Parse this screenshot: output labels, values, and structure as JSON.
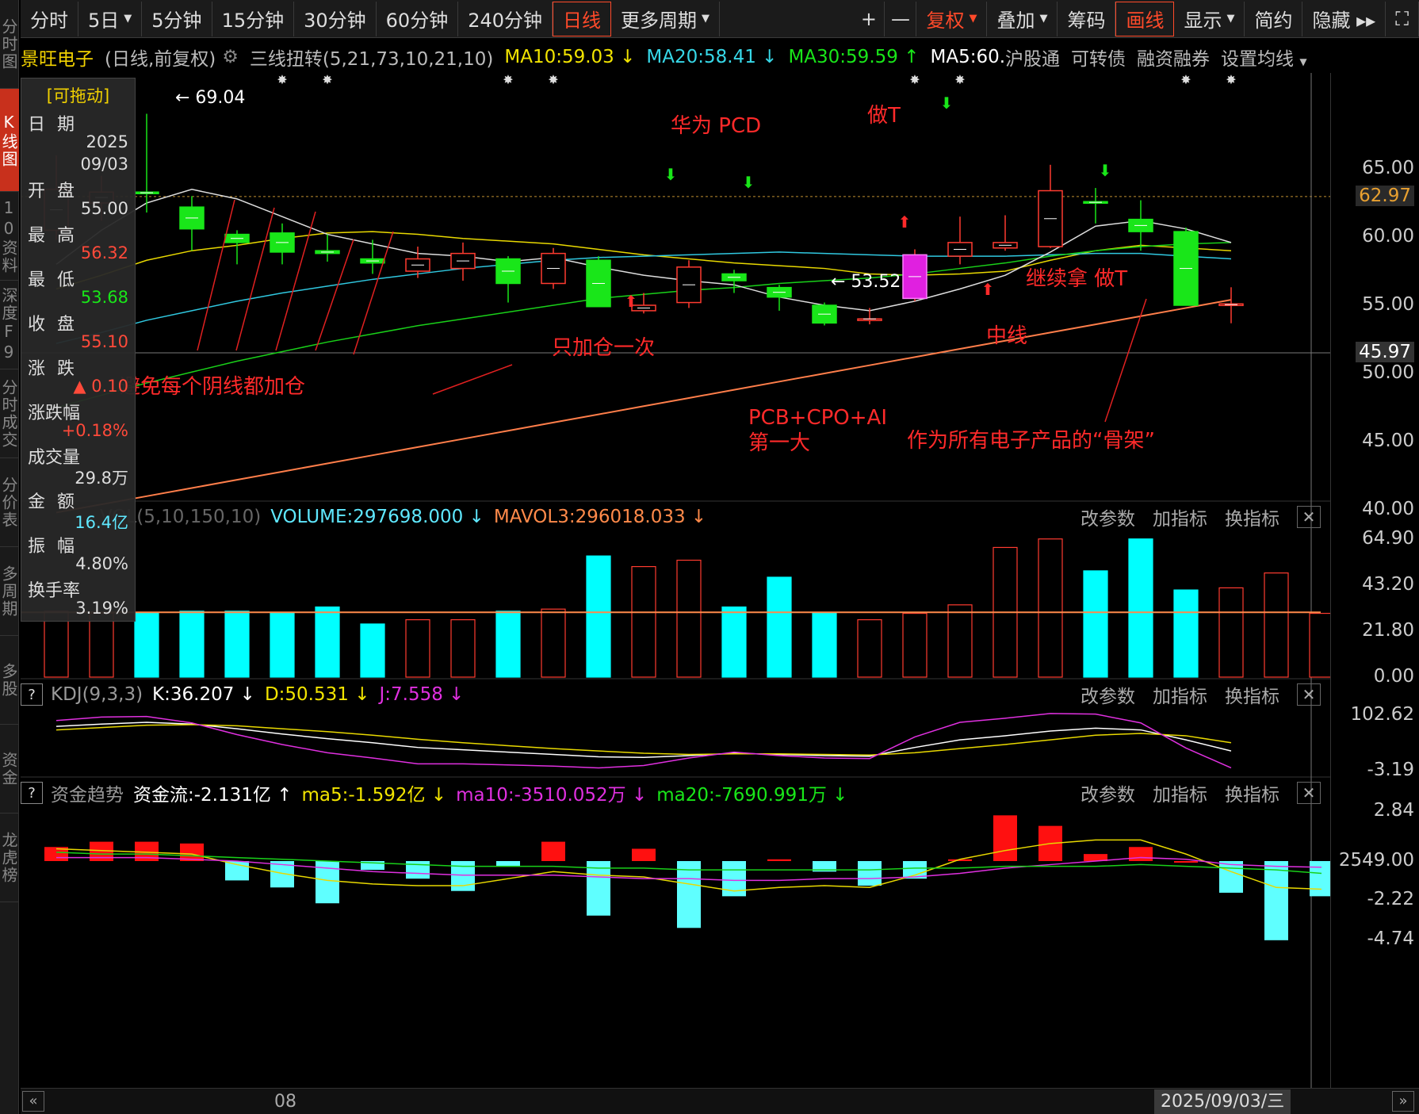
{
  "left_nav": [
    "分时图",
    "K线图",
    "10资料",
    "深度F9",
    "分时成交",
    "分价表",
    "多周期",
    "多股",
    "资金",
    "龙虎榜"
  ],
  "toolbar": {
    "left": [
      {
        "label": "分时"
      },
      {
        "label": "5日",
        "caret": true
      },
      {
        "label": "5分钟"
      },
      {
        "label": "15分钟"
      },
      {
        "label": "30分钟"
      },
      {
        "label": "60分钟"
      },
      {
        "label": "240分钟"
      },
      {
        "label": "日线",
        "active": true
      },
      {
        "label": "更多周期",
        "caret": true
      }
    ],
    "plus": "+",
    "minus": "—",
    "right": [
      {
        "label": "复权",
        "caret": true,
        "red": true
      },
      {
        "label": "叠加",
        "caret": true
      },
      {
        "label": "筹码"
      },
      {
        "label": "画线",
        "active": true
      },
      {
        "label": "显示",
        "caret": true
      },
      {
        "label": "简约"
      },
      {
        "label": "隐藏 ▸▸"
      },
      {
        "label": "⛶"
      }
    ]
  },
  "info": {
    "stock_name": "景旺电子",
    "mode": "(日线,前复权)",
    "indicator": "三线扭转(5,21,73,10,21,10)",
    "ma10": "MA10:59.03",
    "ma20": "MA20:58.41",
    "ma30": "MA30:59.59",
    "ma5": "MA5:60.",
    "links": [
      "沪股通",
      "可转债",
      "融资融券",
      "设置均线"
    ],
    "colors": {
      "ma10": "#f2e400",
      "ma20": "#37d8e8",
      "ma30": "#19e619",
      "ma5": "#ffffff"
    }
  },
  "data_window": {
    "drag_label": "[可拖动]",
    "date_label": "日 期",
    "date_year": "2025",
    "date_md": "09/03",
    "open_label": "开 盘",
    "open": "55.00",
    "high_label": "最 高",
    "high": "56.32",
    "low_label": "最 低",
    "low": "53.68",
    "close_label": "收 盘",
    "close": "55.10",
    "chg_label": "涨 跌",
    "chg": "▲ 0.10",
    "chgpct_label": "涨跌幅",
    "chgpct": "+0.18%",
    "vol_label": "成交量",
    "vol": "29.8万",
    "amt_label": "金 额",
    "amt": "16.4亿",
    "amp_label": "振 幅",
    "amp": "4.80%",
    "turn_label": "换手率",
    "turn": "3.19%"
  },
  "price_axis": [
    "65.00",
    "60.00",
    "55.00",
    "50.00",
    "45.00",
    "40.00"
  ],
  "price_markers": {
    "dashed_price": "62.97",
    "cursor_price": "45.97"
  },
  "candles": [
    {
      "o": 60.5,
      "c": 63.5,
      "h": 66.0,
      "l": 59.8
    },
    {
      "o": 62.5,
      "c": 63.3,
      "h": 64.5,
      "l": 61.2
    },
    {
      "o": 63.3,
      "c": 63.2,
      "h": 69.04,
      "l": 61.8
    },
    {
      "o": 62.2,
      "c": 60.6,
      "h": 63.0,
      "l": 59.0
    },
    {
      "o": 60.2,
      "c": 59.6,
      "h": 60.5,
      "l": 58.0
    },
    {
      "o": 60.3,
      "c": 58.9,
      "h": 61.0,
      "l": 58.0
    },
    {
      "o": 59.0,
      "c": 58.8,
      "h": 60.2,
      "l": 58.2
    },
    {
      "o": 58.4,
      "c": 58.1,
      "h": 59.8,
      "l": 57.3
    },
    {
      "o": 57.5,
      "c": 58.4,
      "h": 59.3,
      "l": 57.0
    },
    {
      "o": 57.7,
      "c": 58.8,
      "h": 59.6,
      "l": 56.8
    },
    {
      "o": 58.4,
      "c": 56.6,
      "h": 58.6,
      "l": 55.2
    },
    {
      "o": 56.6,
      "c": 58.8,
      "h": 59.2,
      "l": 56.2
    },
    {
      "o": 58.3,
      "c": 54.9,
      "h": 58.6,
      "l": 54.9
    },
    {
      "o": 54.6,
      "c": 55.0,
      "h": 55.9,
      "l": 54.4
    },
    {
      "o": 55.2,
      "c": 57.8,
      "h": 58.3,
      "l": 54.8
    },
    {
      "o": 57.3,
      "c": 56.8,
      "h": 57.6,
      "l": 55.9
    },
    {
      "o": 56.3,
      "c": 55.6,
      "h": 56.5,
      "l": 54.6
    },
    {
      "o": 55.0,
      "c": 53.7,
      "h": 55.2,
      "l": 53.52
    },
    {
      "o": 54.0,
      "c": 54.0,
      "h": 54.8,
      "l": 53.6
    },
    {
      "o": 55.5,
      "c": 58.7,
      "h": 59.1,
      "l": 55.3
    },
    {
      "o": 58.6,
      "c": 59.6,
      "h": 61.5,
      "l": 58.0
    },
    {
      "o": 59.2,
      "c": 59.6,
      "h": 61.6,
      "l": 59.0
    },
    {
      "o": 59.3,
      "c": 63.4,
      "h": 65.3,
      "l": 59.2
    },
    {
      "o": 62.6,
      "c": 62.5,
      "h": 63.6,
      "l": 61.0
    },
    {
      "o": 61.3,
      "c": 60.4,
      "h": 62.7,
      "l": 59.0
    },
    {
      "o": 60.4,
      "c": 55.0,
      "h": 60.7,
      "l": 55.0
    },
    {
      "o": 55.0,
      "c": 55.1,
      "h": 56.32,
      "l": 53.68
    }
  ],
  "ma_lines": {
    "ma10": [
      56.2,
      57.2,
      58.3,
      59.0,
      59.4,
      59.9,
      60.3,
      60.4,
      60.2,
      59.9,
      59.7,
      59.5,
      59.1,
      58.7,
      58.4,
      58.1,
      57.9,
      57.7,
      57.3,
      57.2,
      57.3,
      57.5,
      58.3,
      59.0,
      59.4,
      59.2,
      59.0
    ],
    "ma20": [
      52.2,
      53.0,
      53.9,
      54.6,
      55.3,
      55.9,
      56.4,
      56.9,
      57.3,
      57.7,
      58.0,
      58.3,
      58.5,
      58.6,
      58.7,
      58.8,
      58.9,
      58.8,
      58.7,
      58.6,
      58.6,
      58.6,
      58.7,
      58.8,
      58.8,
      58.6,
      58.4
    ],
    "ma30": [
      47.5,
      48.4,
      49.3,
      50.1,
      50.9,
      51.6,
      52.3,
      52.9,
      53.5,
      54.0,
      54.5,
      55.0,
      55.5,
      55.8,
      56.1,
      56.3,
      56.6,
      56.8,
      57.0,
      57.3,
      57.7,
      58.1,
      58.6,
      59.0,
      59.3,
      59.5,
      59.6
    ],
    "ma5": [
      58.0,
      60.5,
      62.5,
      63.5,
      62.8,
      61.5,
      60.2,
      59.5,
      58.8,
      58.6,
      58.2,
      58.5,
      57.8,
      57.2,
      56.8,
      56.5,
      55.6,
      55.0,
      54.6,
      55.3,
      56.2,
      57.2,
      58.9,
      60.8,
      61.2,
      60.6,
      59.6
    ],
    "long": [
      39.8,
      40.4,
      41.0,
      41.6,
      42.2,
      42.8,
      43.4,
      44.0,
      44.6,
      45.2,
      45.8,
      46.4,
      47.0,
      47.6,
      48.2,
      48.8,
      49.4,
      50.0,
      50.6,
      51.2,
      51.8,
      52.4,
      53.0,
      53.6,
      54.2,
      54.8,
      55.4
    ]
  },
  "annotations": {
    "high_label": "69.04",
    "low_label": "53.52",
    "huawei": "华为  PCD",
    "zuot": "做T",
    "zhi_jiacang": "只加仓一次",
    "avoid": "避免每个阴线都加仓",
    "jixu": "继续拿 做T",
    "zhongxian": "中线",
    "pcb1": "PCB+CPO+AI",
    "pcb2": "第一大",
    "gujia": "作为所有电子产品的“骨架”"
  },
  "volume_panel": {
    "prefix": "VOL(5,10,150,10)",
    "volume": "VOLUME:297698.000",
    "mavol": "MAVOL3:296018.033",
    "axis": [
      "64.90",
      "43.20",
      "21.80",
      "0.00"
    ],
    "values": [
      31,
      30,
      30,
      31,
      31,
      30,
      33,
      25,
      27,
      27,
      31,
      32,
      57,
      52,
      55,
      33,
      47,
      30,
      27,
      30,
      34,
      61,
      65,
      50,
      65,
      41,
      42,
      49,
      30
    ],
    "mavol_level": 30.5
  },
  "kdj_panel": {
    "name": "KDJ(9,3,3)",
    "k": "K:36.207",
    "d": "D:50.531",
    "j": "J:7.558",
    "axis": [
      "102.62",
      "-3.19"
    ],
    "k_vals": [
      78,
      82,
      85,
      82,
      74,
      65,
      57,
      50,
      42,
      38,
      34,
      30,
      26,
      25,
      28,
      32,
      30,
      28,
      27,
      42,
      55,
      62,
      70,
      75,
      72,
      55,
      36
    ],
    "d_vals": [
      72,
      76,
      80,
      81,
      79,
      74,
      69,
      63,
      56,
      50,
      45,
      40,
      36,
      32,
      30,
      31,
      31,
      30,
      29,
      33,
      40,
      47,
      55,
      63,
      66,
      62,
      50
    ],
    "j_vals": [
      88,
      94,
      95,
      84,
      64,
      47,
      33,
      24,
      14,
      14,
      12,
      10,
      7,
      11,
      24,
      34,
      28,
      24,
      23,
      60,
      85,
      92,
      100,
      99,
      84,
      41,
      7
    ]
  },
  "money_panel": {
    "name": "资金趋势",
    "flow": "资金流:-2.131亿",
    "ma5": "ma5:-1.592亿",
    "ma10": "ma10:-3510.052万",
    "ma20": "ma20:-7690.991万",
    "axis": [
      "2.84",
      "2549.00",
      "-2.22",
      "-4.74"
    ],
    "bars": [
      0.8,
      1.1,
      1.1,
      1.0,
      -1.1,
      -1.5,
      -2.4,
      -0.5,
      -1.0,
      -1.7,
      -0.3,
      1.1,
      -3.1,
      0.7,
      -3.8,
      -2.0,
      0.1,
      -0.6,
      -1.4,
      -1.0,
      0.1,
      2.6,
      2.0,
      0.4,
      0.8,
      0.0,
      -1.8,
      -4.5,
      -2.0
    ],
    "ma5_vals": [
      0.7,
      0.6,
      0.5,
      0.4,
      -0.2,
      -0.7,
      -1.1,
      -1.3,
      -1.4,
      -1.4,
      -1.0,
      -0.6,
      -0.8,
      -0.9,
      -1.3,
      -1.7,
      -1.5,
      -1.4,
      -1.5,
      -0.8,
      0.1,
      0.6,
      1.0,
      1.2,
      1.2,
      0.4,
      -0.6,
      -1.5,
      -1.6
    ],
    "ma10_vals": [
      0.2,
      0.2,
      0.2,
      0.1,
      0.0,
      -0.2,
      -0.4,
      -0.6,
      -0.7,
      -0.8,
      -0.8,
      -0.8,
      -0.9,
      -1.0,
      -1.0,
      -1.1,
      -1.1,
      -1.0,
      -1.0,
      -0.9,
      -0.7,
      -0.4,
      -0.2,
      0.0,
      0.2,
      0.1,
      -0.2,
      -0.3,
      -0.35
    ],
    "ma20_vals": [
      0.5,
      0.4,
      0.4,
      0.3,
      0.2,
      0.1,
      0.0,
      -0.1,
      -0.2,
      -0.3,
      -0.3,
      -0.3,
      -0.4,
      -0.4,
      -0.5,
      -0.5,
      -0.5,
      -0.5,
      -0.5,
      -0.4,
      -0.4,
      -0.3,
      -0.3,
      -0.3,
      -0.2,
      -0.3,
      -0.4,
      -0.5,
      -0.7
    ]
  },
  "panel_controls": [
    "改参数",
    "加指标",
    "换指标"
  ],
  "bottom": {
    "date_tick": "08",
    "cursor_date": "2025/09/03/三"
  },
  "colors": {
    "up": "#ff3b30",
    "down": "#00e600",
    "down_vol": "#00ffff",
    "long_ma": "#ff7e4a"
  }
}
